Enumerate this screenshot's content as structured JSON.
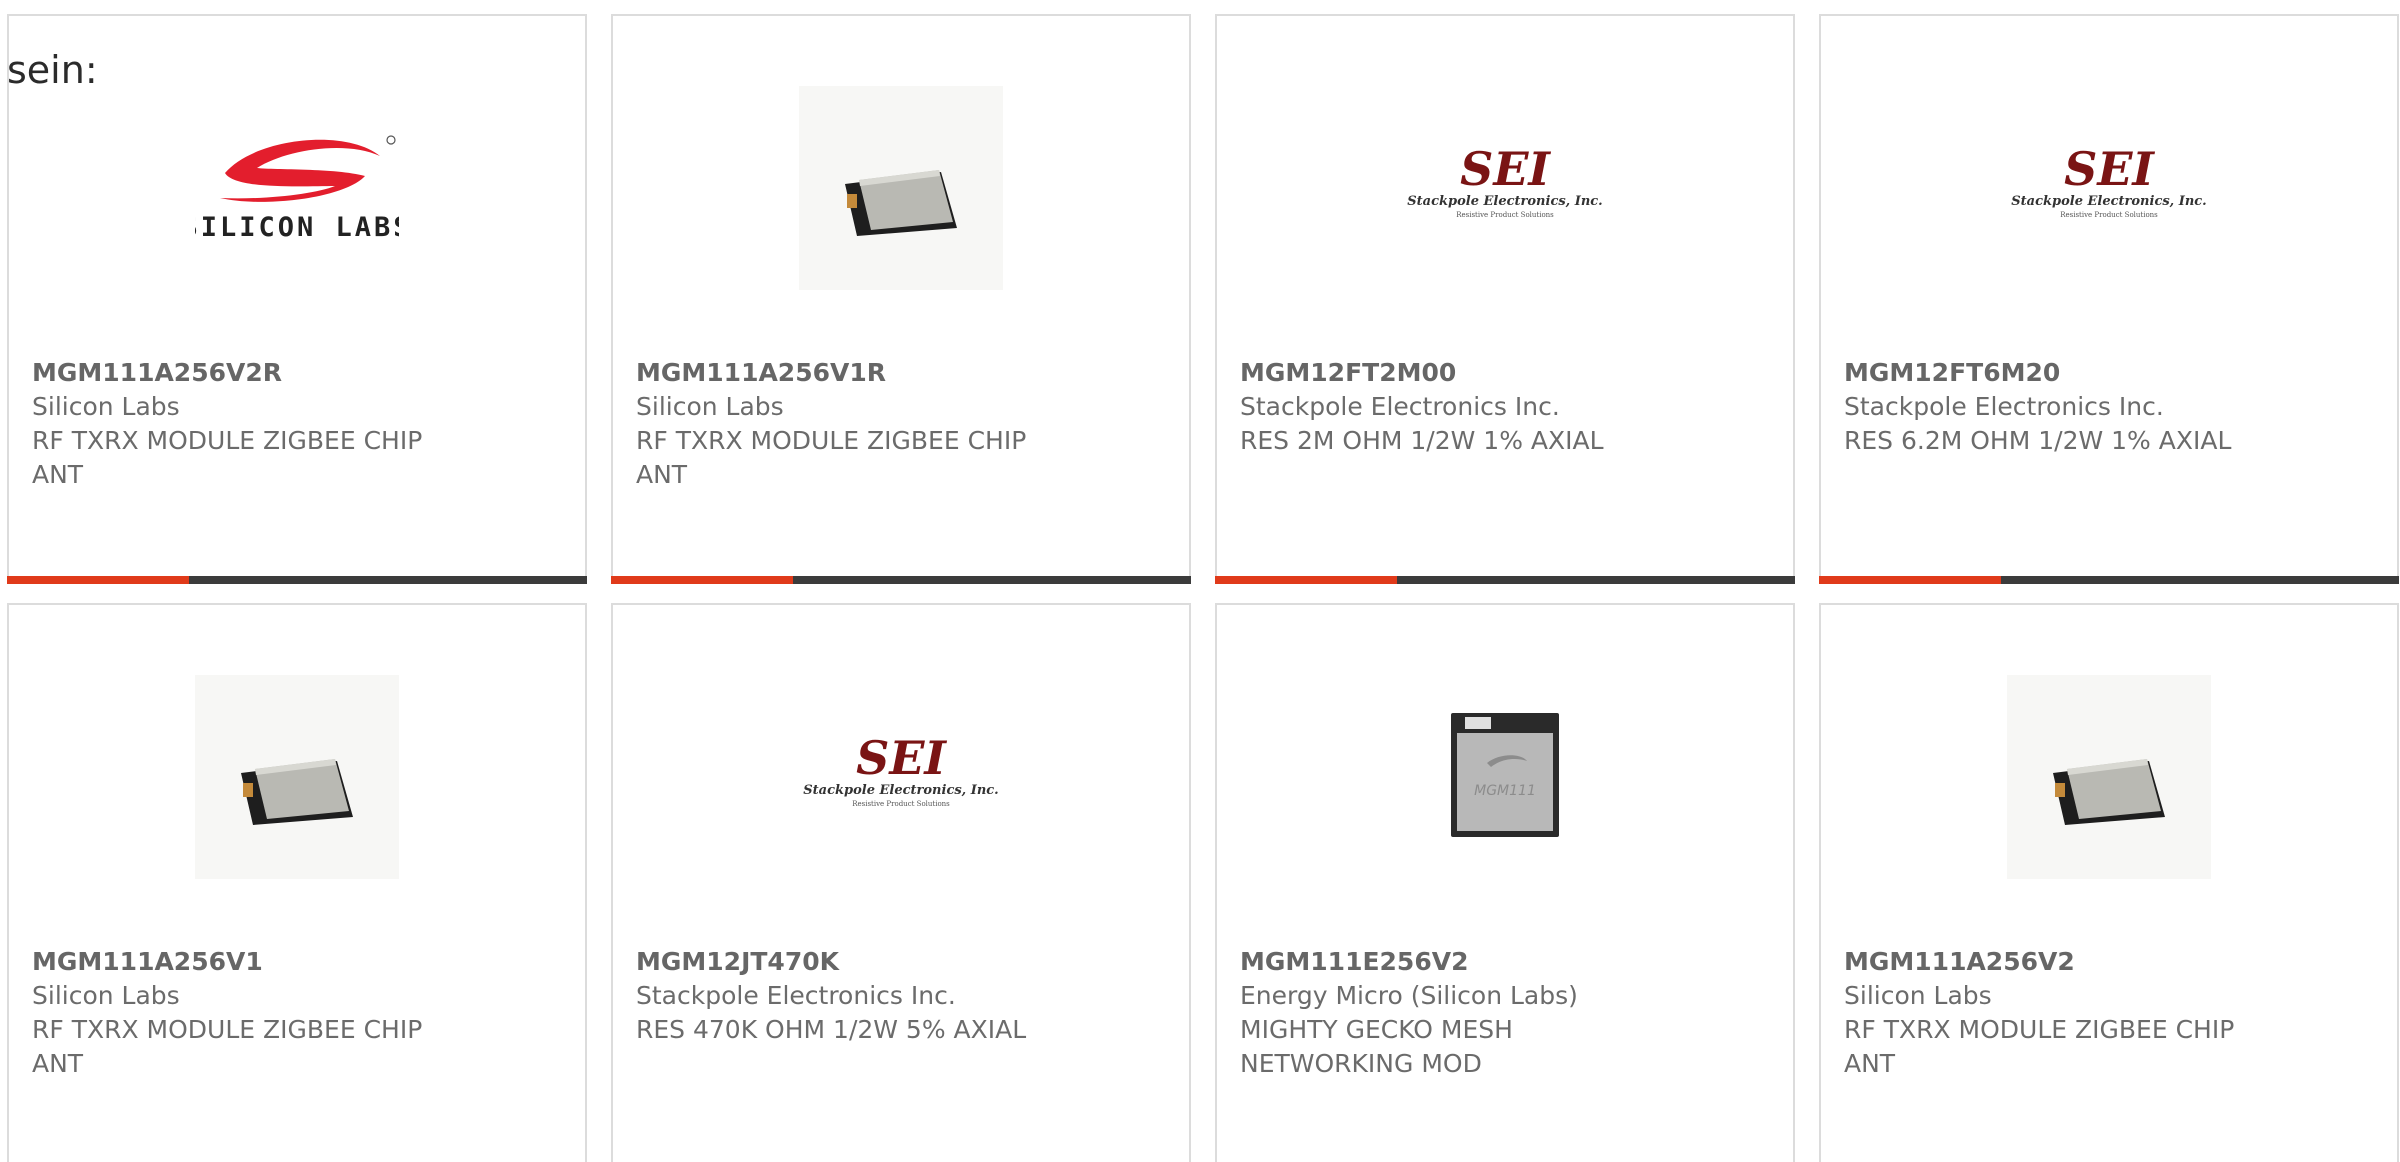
{
  "intro_text": "sein:",
  "colors": {
    "accent_bar": "#e03a1a",
    "dark_bar": "#3b3b3b",
    "card_border": "#dcdcdc",
    "text": "#6b6b6b",
    "silicon_labs_red": "#e31e2d",
    "sei_maroon": "#7a1414"
  },
  "products": [
    {
      "part_number": "MGM111A256V2R",
      "manufacturer": "Silicon Labs",
      "description_line1": "RF TXRX MODULE ZIGBEE CHIP",
      "description_line2": "ANT",
      "image": "silicon-labs-logo",
      "logo_text": "SILICON LABS"
    },
    {
      "part_number": "MGM111A256V1R",
      "manufacturer": "Silicon Labs",
      "description_line1": "RF TXRX MODULE ZIGBEE CHIP",
      "description_line2": "ANT",
      "image": "rf-module-photo"
    },
    {
      "part_number": "MGM12FT2M00",
      "manufacturer": "Stackpole Electronics Inc.",
      "description_line1": "RES 2M OHM 1/2W 1% AXIAL",
      "description_line2": "",
      "image": "sei-logo",
      "logo_text": "SEI",
      "logo_subtext": "Stackpole Electronics, Inc.",
      "logo_tagline": "Resistive Product Solutions"
    },
    {
      "part_number": "MGM12FT6M20",
      "manufacturer": "Stackpole Electronics Inc.",
      "description_line1": "RES 6.2M OHM 1/2W 1% AXIAL",
      "description_line2": "",
      "image": "sei-logo",
      "logo_text": "SEI",
      "logo_subtext": "Stackpole Electronics, Inc.",
      "logo_tagline": "Resistive Product Solutions"
    },
    {
      "part_number": "MGM111A256V1",
      "manufacturer": "Silicon Labs",
      "description_line1": "RF TXRX MODULE ZIGBEE CHIP",
      "description_line2": "ANT",
      "image": "rf-module-photo"
    },
    {
      "part_number": "MGM12JT470K",
      "manufacturer": "Stackpole Electronics Inc.",
      "description_line1": "RES 470K OHM 1/2W 5% AXIAL",
      "description_line2": "",
      "image": "sei-logo",
      "logo_text": "SEI",
      "logo_subtext": "Stackpole Electronics, Inc.",
      "logo_tagline": "Resistive Product Solutions"
    },
    {
      "part_number": "MGM111E256V2",
      "manufacturer": "Energy Micro (Silicon Labs)",
      "description_line1": "MIGHTY GECKO MESH",
      "description_line2": "NETWORKING MOD",
      "image": "mighty-gecko-module-photo",
      "chip_text": "MGM111"
    },
    {
      "part_number": "MGM111A256V2",
      "manufacturer": "Silicon Labs",
      "description_line1": "RF TXRX MODULE ZIGBEE CHIP",
      "description_line2": "ANT",
      "image": "rf-module-photo"
    }
  ]
}
